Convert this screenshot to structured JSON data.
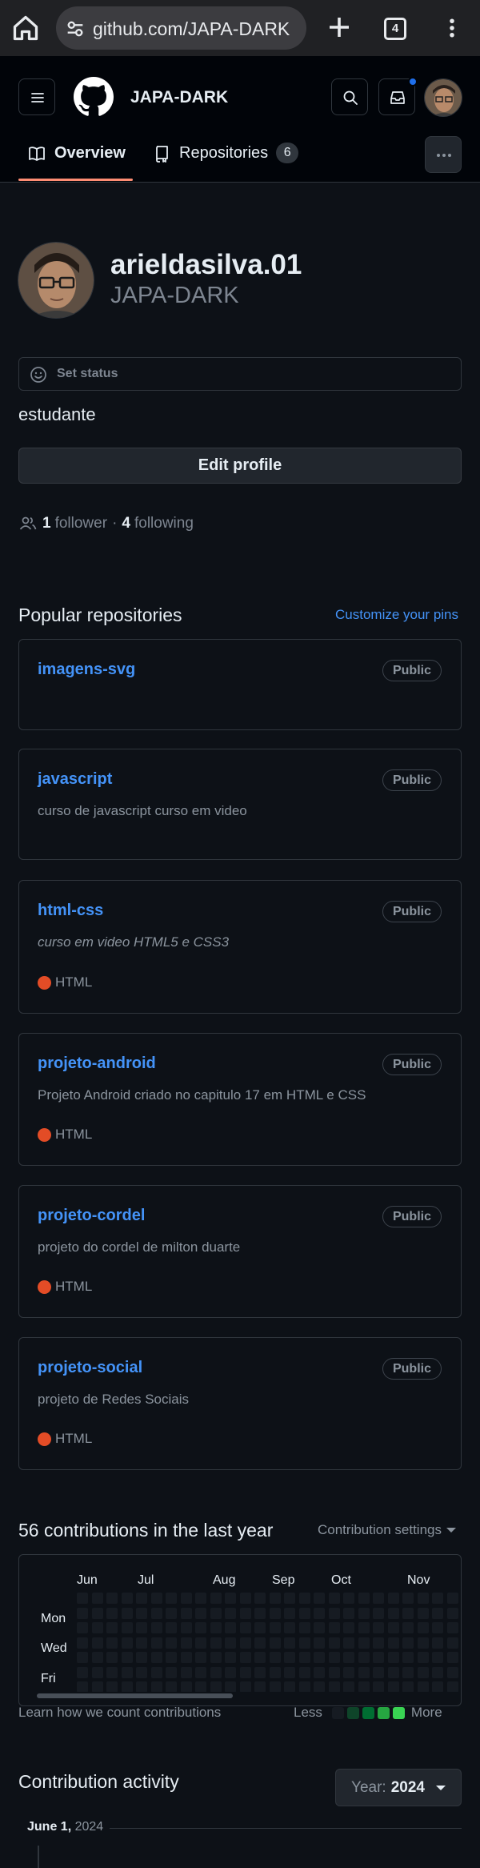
{
  "browser": {
    "url": "github.com/JAPA-DARK",
    "tab_count": "4",
    "icons": [
      "home-icon",
      "site-settings-icon",
      "new-tab-icon",
      "tab-switcher-icon",
      "overflow-menu-icon"
    ]
  },
  "header": {
    "owner": "JAPA-DARK",
    "tabs": [
      {
        "label": "Overview",
        "selected": true
      },
      {
        "label": "Repositories",
        "count": "6",
        "selected": false
      }
    ],
    "accent_color": "#fd8c73",
    "notification_color": "#1f6feb"
  },
  "profile": {
    "name": "arieldasilva.01",
    "login": "JAPA-DARK",
    "set_status_label": "Set status",
    "bio": "estudante",
    "edit_profile_label": "Edit profile",
    "followers_count": "1",
    "followers_label": "follower",
    "separator": "·",
    "following_count": "4",
    "following_label": "following"
  },
  "popular": {
    "title": "Popular repositories",
    "customize_label": "Customize your pins",
    "repos": [
      {
        "name": "imagens-svg",
        "badge": "Public",
        "description": "",
        "language": ""
      },
      {
        "name": "javascript",
        "badge": "Public",
        "description": "curso de javascript curso em video",
        "language": ""
      },
      {
        "name": "html-css",
        "badge": "Public",
        "description": "curso em video HTML5 e CSS3",
        "language": "HTML"
      },
      {
        "name": "projeto-android",
        "badge": "Public",
        "description": "Projeto Android criado no capitulo 17 em HTML e CSS",
        "language": "HTML"
      },
      {
        "name": "projeto-cordel",
        "badge": "Public",
        "description": "projeto do cordel de milton duarte",
        "language": "HTML"
      },
      {
        "name": "projeto-social",
        "badge": "Public",
        "description": "projeto de Redes Sociais",
        "language": "HTML"
      }
    ],
    "html_language_color": "#e34c26",
    "link_color": "#4493f8"
  },
  "contributions": {
    "title": "56 contributions in the last year",
    "settings_label": "Contribution settings",
    "months": [
      "Jun",
      "Jul",
      "Aug",
      "Sep",
      "Oct",
      "Nov"
    ],
    "weekdays": [
      "Mon",
      "Wed",
      "Fri"
    ],
    "learn_label": "Learn how we count contributions",
    "legend_less": "Less",
    "legend_more": "More",
    "legend_colors": [
      "#161b22",
      "#0e4429",
      "#006d32",
      "#26a641",
      "#39d353"
    ]
  },
  "activity": {
    "title": "Contribution activity",
    "year_label": "Year:",
    "year_value": "2024",
    "date_label": "June 1,",
    "date_year": "2024"
  }
}
